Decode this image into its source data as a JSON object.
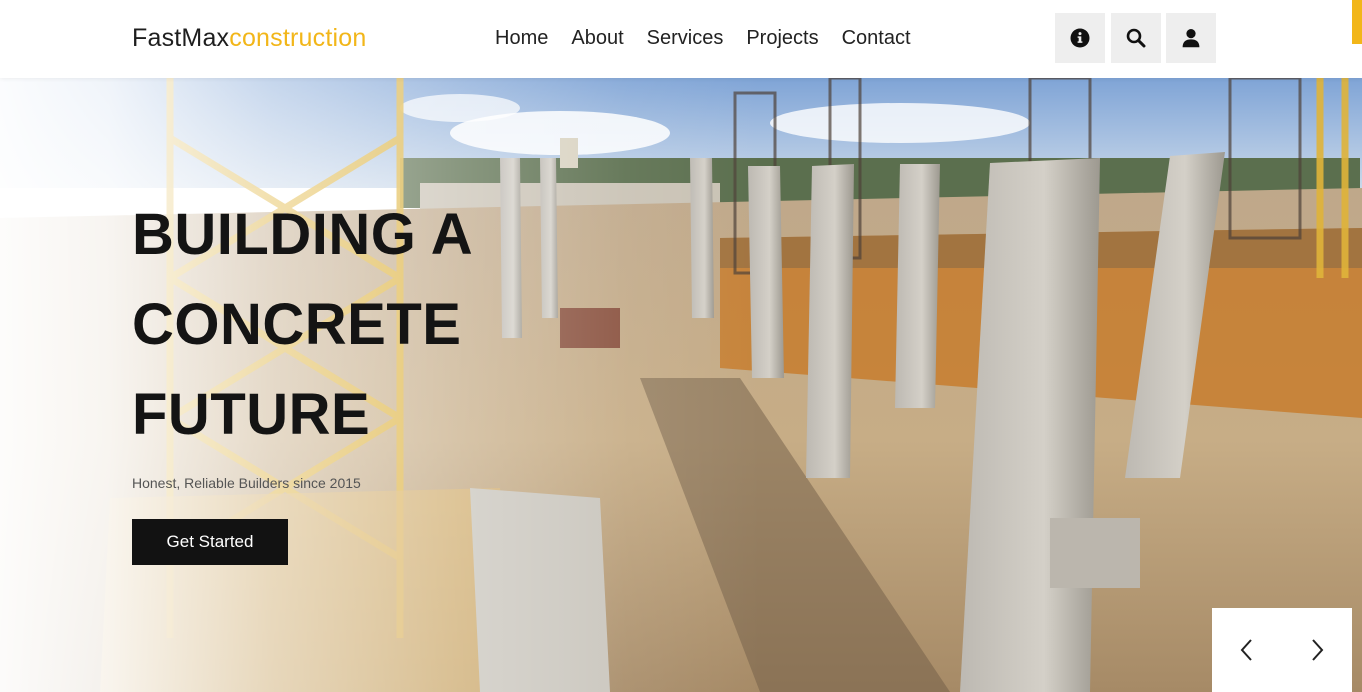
{
  "header": {
    "logo": {
      "part1": "FastMax",
      "part2": "construction"
    },
    "nav": [
      "Home",
      "About",
      "Services",
      "Projects",
      "Contact"
    ],
    "icons": [
      "info-icon",
      "search-icon",
      "user-icon"
    ]
  },
  "hero": {
    "title": "BUILDING A CONCRETE FUTURE",
    "subtitle": "Honest, Reliable Builders since 2015",
    "cta_label": "Get Started",
    "prev_icon": "chevron-left-icon",
    "next_icon": "chevron-right-icon"
  },
  "colors": {
    "accent": "#f2b619",
    "dark": "#121212",
    "icon_bg": "#eeeeee"
  }
}
